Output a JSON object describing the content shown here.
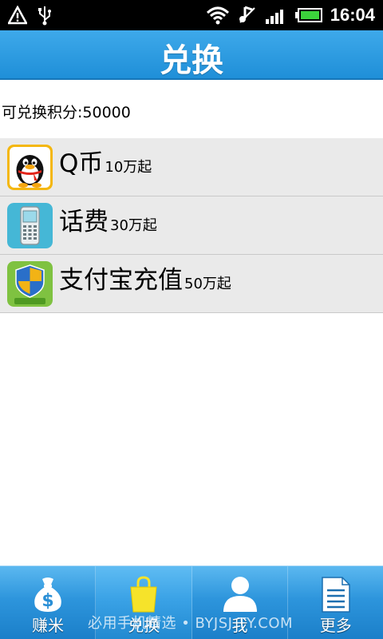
{
  "status_bar": {
    "time": "16:04",
    "icons": [
      "alert-icon",
      "usb-icon",
      "wifi-icon",
      "vibrate-icon",
      "signal-icon",
      "battery-icon"
    ]
  },
  "header": {
    "title": "兑换"
  },
  "points": {
    "label": "可兑换积分:50000"
  },
  "rewards": [
    {
      "name": "Q币",
      "requirement": "10万起",
      "icon": "qq-penguin-icon"
    },
    {
      "name": "话费",
      "requirement": "30万起",
      "icon": "mobile-phone-icon"
    },
    {
      "name": "支付宝充值",
      "requirement": "50万起",
      "icon": "alipay-shield-icon"
    }
  ],
  "bottom_nav": {
    "items": [
      {
        "label": "赚米",
        "icon": "money-bag-icon"
      },
      {
        "label": "兑换",
        "icon": "shopping-bag-icon",
        "active": true
      },
      {
        "label": "我",
        "icon": "user-icon"
      },
      {
        "label": "更多",
        "icon": "document-icon"
      }
    ]
  },
  "watermark": {
    "text": "必用手机精选 • BYJSJ.TY.COM"
  },
  "colors": {
    "title_bar": "#2a9be0",
    "nav_bar": "#2d95dc",
    "list_row": "#eaeaea",
    "status_bar": "#000000"
  }
}
